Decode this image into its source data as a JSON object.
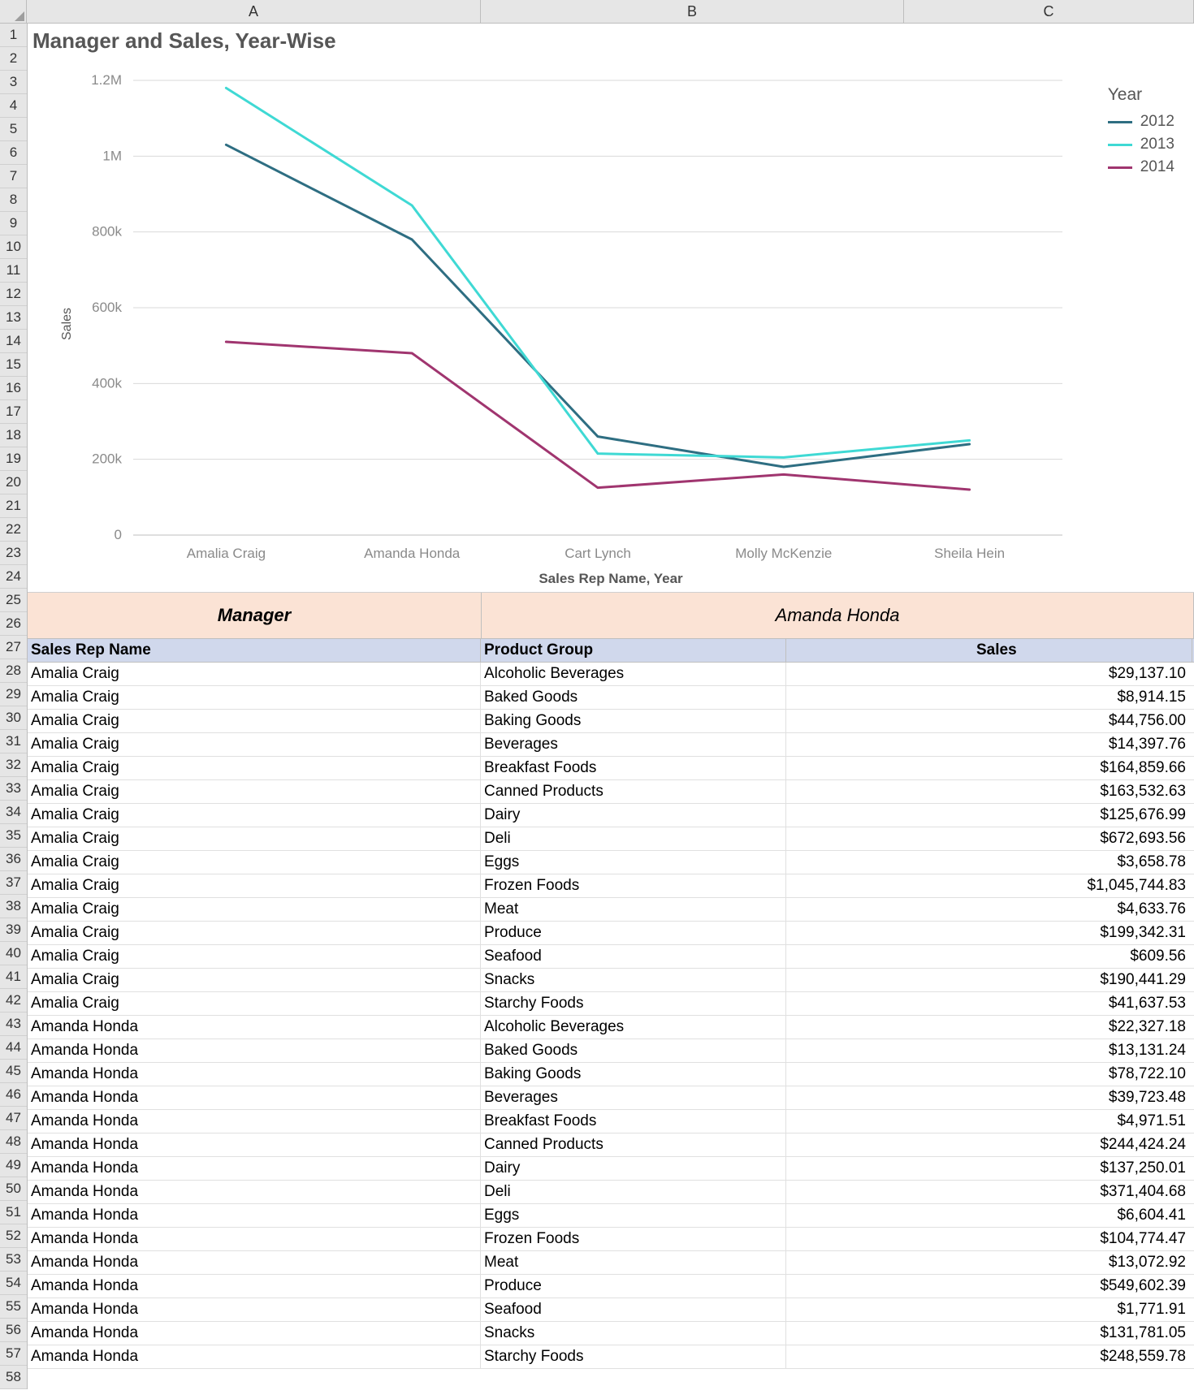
{
  "columns": [
    "A",
    "B",
    "C"
  ],
  "row_numbers": [
    1,
    2,
    3,
    4,
    5,
    6,
    7,
    8,
    9,
    10,
    11,
    12,
    13,
    14,
    15,
    16,
    17,
    18,
    19,
    20,
    21,
    22,
    23,
    24,
    25,
    26,
    27,
    28,
    29,
    30,
    31,
    32,
    33,
    34,
    35,
    36,
    37,
    38,
    39,
    40,
    41,
    42,
    43,
    44,
    45,
    46,
    47,
    48,
    49,
    50,
    51,
    52,
    53,
    54,
    55,
    56,
    57,
    58
  ],
  "chart_data": {
    "type": "line",
    "title": "Manager and Sales, Year-Wise",
    "xlabel": "Sales Rep Name, Year",
    "ylabel": "Sales",
    "ylim": [
      0,
      1200000
    ],
    "y_ticks": [
      0,
      200000,
      400000,
      600000,
      800000,
      1000000,
      1200000
    ],
    "y_tick_labels": [
      "0",
      "200k",
      "400k",
      "600k",
      "800k",
      "1M",
      "1.2M"
    ],
    "categories": [
      "Amalia Craig",
      "Amanda Honda",
      "Cart Lynch",
      "Molly McKenzie",
      "Sheila Hein"
    ],
    "series": [
      {
        "name": "2012",
        "color": "#2e6e82",
        "values": [
          1030000,
          780000,
          260000,
          180000,
          240000
        ]
      },
      {
        "name": "2013",
        "color": "#3fd9d4",
        "values": [
          1180000,
          870000,
          215000,
          205000,
          250000
        ]
      },
      {
        "name": "2014",
        "color": "#a0356f",
        "values": [
          510000,
          480000,
          125000,
          160000,
          120000
        ]
      }
    ],
    "legend_title": "Year",
    "legend_position": "right"
  },
  "manager_header": {
    "label": "Manager",
    "value": "Amanda Honda"
  },
  "table_headers": {
    "a": "Sales Rep Name",
    "b": "Product Group",
    "c": "Sales"
  },
  "table_rows": [
    {
      "rep": "Amalia Craig",
      "group": "Alcoholic Beverages",
      "sales": "$29,137.10"
    },
    {
      "rep": "Amalia Craig",
      "group": "Baked Goods",
      "sales": "$8,914.15"
    },
    {
      "rep": "Amalia Craig",
      "group": "Baking Goods",
      "sales": "$44,756.00"
    },
    {
      "rep": "Amalia Craig",
      "group": "Beverages",
      "sales": "$14,397.76"
    },
    {
      "rep": "Amalia Craig",
      "group": "Breakfast Foods",
      "sales": "$164,859.66"
    },
    {
      "rep": "Amalia Craig",
      "group": "Canned Products",
      "sales": "$163,532.63"
    },
    {
      "rep": "Amalia Craig",
      "group": "Dairy",
      "sales": "$125,676.99"
    },
    {
      "rep": "Amalia Craig",
      "group": "Deli",
      "sales": "$672,693.56"
    },
    {
      "rep": "Amalia Craig",
      "group": "Eggs",
      "sales": "$3,658.78"
    },
    {
      "rep": "Amalia Craig",
      "group": "Frozen Foods",
      "sales": "$1,045,744.83"
    },
    {
      "rep": "Amalia Craig",
      "group": "Meat",
      "sales": "$4,633.76"
    },
    {
      "rep": "Amalia Craig",
      "group": "Produce",
      "sales": "$199,342.31"
    },
    {
      "rep": "Amalia Craig",
      "group": "Seafood",
      "sales": "$609.56"
    },
    {
      "rep": "Amalia Craig",
      "group": "Snacks",
      "sales": "$190,441.29"
    },
    {
      "rep": "Amalia Craig",
      "group": "Starchy Foods",
      "sales": "$41,637.53"
    },
    {
      "rep": "Amanda Honda",
      "group": "Alcoholic Beverages",
      "sales": "$22,327.18"
    },
    {
      "rep": "Amanda Honda",
      "group": "Baked Goods",
      "sales": "$13,131.24"
    },
    {
      "rep": "Amanda Honda",
      "group": "Baking Goods",
      "sales": "$78,722.10"
    },
    {
      "rep": "Amanda Honda",
      "group": "Beverages",
      "sales": "$39,723.48"
    },
    {
      "rep": "Amanda Honda",
      "group": "Breakfast Foods",
      "sales": "$4,971.51"
    },
    {
      "rep": "Amanda Honda",
      "group": "Canned Products",
      "sales": "$244,424.24"
    },
    {
      "rep": "Amanda Honda",
      "group": "Dairy",
      "sales": "$137,250.01"
    },
    {
      "rep": "Amanda Honda",
      "group": "Deli",
      "sales": "$371,404.68"
    },
    {
      "rep": "Amanda Honda",
      "group": "Eggs",
      "sales": "$6,604.41"
    },
    {
      "rep": "Amanda Honda",
      "group": "Frozen Foods",
      "sales": "$104,774.47"
    },
    {
      "rep": "Amanda Honda",
      "group": "Meat",
      "sales": "$13,072.92"
    },
    {
      "rep": "Amanda Honda",
      "group": "Produce",
      "sales": "$549,602.39"
    },
    {
      "rep": "Amanda Honda",
      "group": "Seafood",
      "sales": "$1,771.91"
    },
    {
      "rep": "Amanda Honda",
      "group": "Snacks",
      "sales": "$131,781.05"
    },
    {
      "rep": "Amanda Honda",
      "group": "Starchy Foods",
      "sales": "$248,559.78"
    }
  ]
}
